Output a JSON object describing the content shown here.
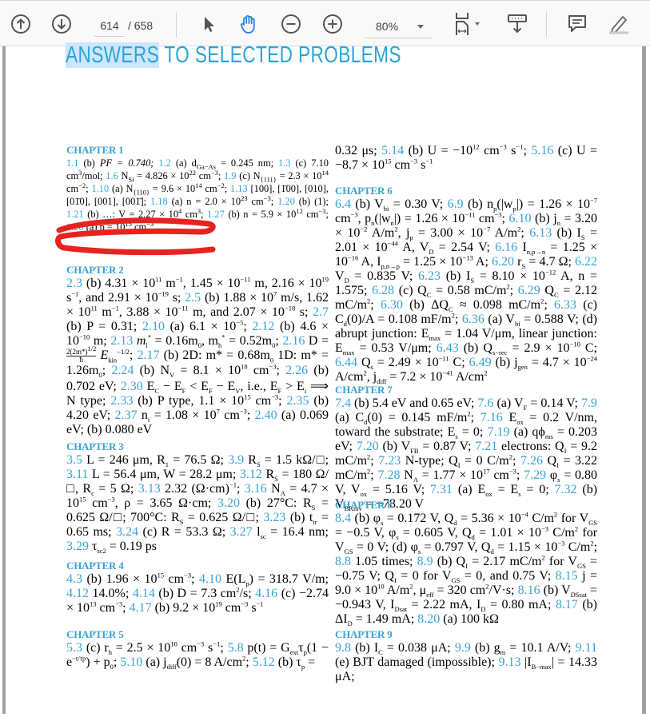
{
  "toolbar": {
    "prev_page_icon": "arrow-up-circle-icon",
    "next_page_icon": "arrow-down-circle-icon",
    "current_page": "614",
    "total_pages": "/ 658",
    "select_tool_icon": "cursor-arrow-icon",
    "hand_tool_icon": "hand-icon",
    "zoom_out_icon": "minus-circle-icon",
    "zoom_in_icon": "plus-circle-icon",
    "zoom_level": "80%",
    "fit_page_icon": "fit-width-icon",
    "scroll_mode_icon": "keyboard-down-icon",
    "comment_icon": "comment-icon",
    "highlight_icon": "pen-highlight-icon",
    "accent_color": "#2b7de9"
  },
  "document": {
    "title_highlighted": "ANSWERS",
    "title_rest": " TO SELECTED PROBLEMS",
    "title_color": "#2ba4d8",
    "highlight_color": "#cde6fb",
    "annotation_color": "#e8231f",
    "chapters": [
      {
        "heading": "CHAPTER 1"
      },
      {
        "heading": "CHAPTER 2"
      },
      {
        "heading": "CHAPTER 3"
      },
      {
        "heading": "CHAPTER 4"
      },
      {
        "heading": "CHAPTER 5"
      },
      {
        "heading": "CHAPTER 6"
      },
      {
        "heading": "CHAPTER 7"
      },
      {
        "heading": "CHAPTER 8"
      },
      {
        "heading": "CHAPTER 9"
      }
    ],
    "ch1": {
      "n1_1": "1.1",
      "t1_1": " (b) ",
      "v1_1": "PF = 0.740; ",
      "n1_2": "1.2",
      "t1_2": " (a) d",
      "s1_2": "Ga−As",
      "v1_2": " = 0.245 nm; ",
      "n1_3": "1.3",
      "t1_3": " (c) 7.10 cm",
      "s1_3": "3",
      "v1_3": "/mol; ",
      "n1_6": "1.6",
      "t1_6": " N",
      "s1_6": "Si",
      "v1_6": " = 4.826 × 10",
      "e1_6": "22",
      "w1_6": " cm",
      "x1_6": "−3",
      "y1_6": "; ",
      "n1_9": "1.9",
      "t1_9": " (c) N",
      "s1_9": "{111}",
      "v1_9": " = 2.3 × 10",
      "e1_9": "14",
      "w1_9": " cm",
      "x1_9": "−2",
      "y1_9": "; ",
      "n1_10": "1.10",
      "t1_10": " (a) N",
      "s1_10": "{110}",
      "v1_10": " = 9.6 × 10",
      "e1_10": "14",
      "w1_10": " cm",
      "x1_10": "−2",
      "y1_10": "; ",
      "n1_13": "1.13",
      "t1_13": " [100], [1̄00], [010], [01̄0], [001], [001̄]; ",
      "n1_18": "1.18",
      "t1_18": " (a) n = 2.0 × 10",
      "e1_18": "23",
      "w1_18": " cm",
      "x1_18": "−3",
      "y1_18": "; ",
      "n1_20": "1.20",
      "t1_20": " (b) (1); ",
      "n1_21": "1.21",
      "t1_21": " (b) ",
      "obscured": "…: V = 2.27 × 10",
      "e_obs": "4",
      "w_obs": " cm",
      "x_obs": "3",
      "y_obs": ";",
      "n1_27": "1.27",
      "t1_27": " (b) n = 5.9 × 10",
      "e1_27": "12",
      "w1_27": " cm",
      "x1_27": "−3",
      "y1_27": "; ",
      "n1_28": "1.28",
      "t1_28": " (a) p = 10",
      "e1_28": "15",
      "w1_28": " cm",
      "x1_28": "−3"
    },
    "ch2": {
      "n2_3": "2.3",
      "t2_3": " (b) 4.31 × 10",
      "e2_3a": "11",
      "a2_3": " m",
      "b2_3": "−1",
      "c2_3": ", 1.45 × 10",
      "d2_3": "−11",
      "f2_3": " m, 2.16 × 10",
      "g2_3": "19",
      "h2_3": " s",
      "i2_3": "−1",
      "j2_3": ", and 2.91 × 10",
      "k2_3": "−19",
      "l2_3": " s; ",
      "n2_5": "2.5",
      "t2_5": " (b) 1.88 × 10",
      "e2_5": "7",
      "a2_5": " m/s, 1.62 × 10",
      "b2_5": "11",
      "c2_5": " m",
      "d2_5": "−1",
      "f2_5": ", 3.88 × 10",
      "g2_5": "−11",
      "h2_5": " m, and 2.07 × 10",
      "i2_5": "−18",
      "j2_5": " s; ",
      "n2_7": "2.7",
      "t2_7": " (b) P = 0.31; ",
      "n2_10": "2.10",
      "t2_10": " (a) 6.1 × 10",
      "e2_10": "−5",
      "y2_10": "; ",
      "n2_12": "2.12",
      "t2_12": " (b) 4.6 × 10",
      "e2_12": "−10",
      "y2_12": " m; ",
      "n2_13": "2.13",
      "t2_13": " m",
      "s2_13a": "l",
      "e2_13a": "*",
      "a2_13": " = 0.16m",
      "b2_13": "0",
      "c2_13": ", m",
      "s2_13b": "h",
      "e2_13b": "*",
      "d2_13": " = 0.52m",
      "f2_13": "0",
      "y2_13": "; ",
      "n2_16": "2.16",
      "t2_16": " D = ",
      "frac_num": "2(2m*)",
      "frac_num_exp": "1/2",
      "frac_den": "ħ",
      "ekin": " E",
      "ekin_sub": "kin",
      "ekin_exp": "−1/2",
      "y2_16": "; ",
      "n2_17": "2.17",
      "t2_17": " (b) 2D: m* = 0.68m",
      "s2_17a": "0",
      "a2_17": " 1D: m* = 1.26m",
      "s2_17b": "0",
      "y2_17": "; ",
      "n2_24": "2.24",
      "t2_24": " (b) N",
      "s2_24": "V",
      "a2_24": " = 8.1 × 10",
      "e2_24": "18",
      "b2_24": " cm",
      "c2_24": "−3",
      "y2_24": "; ",
      "n2_26": "2.26",
      "t2_26": " (b) 0.702 eV; ",
      "n2_30": "2.30",
      "t2_30": " E",
      "s2_30a": "C",
      "a2_30": " − E",
      "s2_30b": "F",
      "b2_30": " < E",
      "s2_30c": "F",
      "c2_30": " − E",
      "s2_30d": "V",
      "d2_30": ", i.e., E",
      "s2_30e": "F",
      "f2_30": " > E",
      "s2_30f": "i",
      "g2_30": " ⟹ N type; ",
      "n2_33": "2.33",
      "t2_33": " (b) P type, 1.1 × 10",
      "e2_33": "15",
      "a2_33": " cm",
      "b2_33": "−3",
      "y2_33": "; ",
      "n2_35": "2.35",
      "t2_35": " (b) 4.20 eV; ",
      "n2_37": "2.37",
      "t2_37": " n",
      "s2_37": "i",
      "a2_37": " = 1.08 × 10",
      "e2_37": "7",
      "b2_37": " cm",
      "c2_37": "−3",
      "y2_37": "; ",
      "n2_40": "2.40",
      "t2_40": " (a) 0.069 eV; (b) 0.080 eV"
    },
    "ch3": {
      "n3_5": "3.5",
      "t3_5": " L = 246 μm, R",
      "s3_5": "1",
      "a3_5": " = 76.5 Ω; ",
      "n3_9": "3.9",
      "t3_9": " R",
      "s3_9": "S",
      "a3_9": " = 1.5 kΩ/□; ",
      "n3_11": "3.11",
      "t3_11": " L = 56.4 μm, W = 28.2 μm; ",
      "n3_12": "3.12",
      "t3_12": " R",
      "s3_12": "S",
      "a3_12": " = 180 Ω/□, R",
      "s3_12b": "c",
      "b3_12": " = 5 Ω; ",
      "n3_13": "3.13",
      "t3_13": " 2.32 (Ω·cm)",
      "e3_13": "−1",
      "y3_13": "; ",
      "n3_16": "3.16",
      "t3_16": " N",
      "s3_16": "A",
      "a3_16": " = 4.7 × 10",
      "e3_16": "15",
      "b3_16": " cm",
      "c3_16": "−3",
      "d3_16": ", ρ = 3.65 Ω·cm; ",
      "n3_20": "3.20",
      "t3_20": " (b) 27°C: R",
      "s3_20": "S",
      "a3_20": " = 0.625 Ω/□; 700°C: R",
      "s3_20b": "S",
      "b3_20": " = 0.625 Ω/□; ",
      "n3_23": "3.23",
      "t3_23": " (b) t",
      "s3_23": "tr",
      "a3_23": " = 0.65 ms; ",
      "n3_24": "3.24",
      "t3_24": " (c) R = 53.3 Ω; ",
      "n3_27": "3.27",
      "t3_27": " l",
      "s3_27": "sc",
      "a3_27": " = 16.4 nm; ",
      "n3_29": "3.29",
      "t3_29": " τ",
      "s3_29": "sc2",
      "a3_29": " = 0.19 ps"
    },
    "ch4": {
      "n4_3": "4.3",
      "t4_3": " (b) 1.96 × 10",
      "e4_3": "15",
      "a4_3": " cm",
      "b4_3": "−3",
      "y4_3": "; ",
      "n4_10": "4.10",
      "t4_10": " E(L",
      "s4_10": "p",
      "a4_10": ") = 318.7 V/m; ",
      "n4_12": "4.12",
      "t4_12": " 14.0%; ",
      "n4_14": "4.14",
      "t4_14": " (b) D = 7.3 cm",
      "e4_14": "2",
      "a4_14": "/s; ",
      "n4_16": "4.16",
      "t4_16": " (c) −2.74 × 10",
      "e4_16": "13",
      "a4_16": " cm",
      "b4_16": "−3",
      "y4_16": "; ",
      "n4_17": "4.17",
      "t4_17": " (b) 9.2 × 10",
      "e4_17": "19",
      "a4_17": " cm",
      "b4_17": "−3",
      "c4_17": " s",
      "d4_17": "−1"
    },
    "ch5": {
      "n5_3": "5.3",
      "t5_3": " (c) r",
      "s5_3": "h",
      "a5_3": " = 2.5 × 10",
      "e5_3": "10",
      "b5_3": " cm",
      "c5_3": "−3",
      "d5_3": " s",
      "f5_3": "−1",
      "y5_3": "; ",
      "n5_8": "5.8",
      "t5_8": " p(t) = G",
      "s5_8a": "ext",
      "a5_8": "τ",
      "s5_8b": "p",
      "b5_8": "(1 − e",
      "e5_8": "−t/τp",
      "c5_8": ") + p",
      "s5_8c": "0",
      "y5_8": "; ",
      "n5_10": "5.10",
      "t5_10": " (a) j",
      "s5_10": "diff",
      "a5_10": "(0) = 8 A/cm",
      "e5_10": "2",
      "y5_10": "; ",
      "n5_12": "5.12",
      "t5_12": " (b) τ",
      "s5_12": "p",
      "a5_12": " = 0.32 μs; ",
      "n5_14": "5.14",
      "t5_14": " (b) U = −10",
      "e5_14": "12",
      "a5_14": " cm",
      "b5_14": "−3",
      "c5_14": " s",
      "d5_14": "−1",
      "y5_14": "; ",
      "n5_16": "5.16",
      "t5_16": " (c) U = −8.7 × 10",
      "e5_16": "15",
      "a5_16": " cm",
      "b5_16": "−3",
      "c5_16": " s",
      "d5_16": "−1"
    },
    "ch6": {
      "n6_4": "6.4",
      "t6_4": " (b) V",
      "s6_4": "bi",
      "a6_4": " = 0.30 V; ",
      "n6_9": "6.9",
      "t6_9": " (b) n",
      "s6_9a": "p",
      "a6_9": "(|w",
      "s6_9b": "p",
      "b6_9": "|) = 1.26 × 10",
      "e6_9a": "−7",
      "c6_9": " cm",
      "d6_9": "−3",
      "f6_9": ", p",
      "s6_9c": "n",
      "g6_9": "(|w",
      "s6_9d": "n",
      "h6_9": "|) = 1.26 × 10",
      "e6_9b": "−11",
      "i6_9": " cm",
      "j6_9": "−3",
      "y6_9": "; ",
      "n6_10": "6.10",
      "t6_10": " (b) j",
      "s6_10a": "n",
      "a6_10": " = 3.20 × 10",
      "e6_10a": "−2",
      "b6_10": " A/m",
      "c6_10": "2",
      "d6_10": ", j",
      "s6_10b": "p",
      "f6_10": " = 3.00 × 10",
      "e6_10b": "−7",
      "g6_10": " A/m",
      "h6_10": "2",
      "y6_10": "; ",
      "n6_13": "6.13",
      "t6_13": " (b) I",
      "s6_13a": "S",
      "a6_13": " = 2.01 × 10",
      "e6_13": "−44",
      "b6_13": " A, V",
      "s6_13b": "D",
      "c6_13": " = 2.54 V; ",
      "n6_16": "6.16",
      "t6_16": " I",
      "s6_16a": "n,p→n",
      "a6_16": " = 1.25 × 10",
      "e6_16a": "−16",
      "b6_16": " A, I",
      "s6_16b": "p,n→p",
      "c6_16": " = 1.25 × 10",
      "e6_16b": "−13",
      "d6_16": " A; ",
      "n6_20": "6.20",
      "t6_20": " r",
      "s6_20": "S",
      "a6_20": " = 4.7 Ω; ",
      "n6_22": "6.22",
      "t6_22": " V",
      "s6_22": "D",
      "a6_22": " = 0.835 V; ",
      "n6_23": "6.23",
      "t6_23": " (b) I",
      "s6_23": "S",
      "a6_23": " = 8.10 × 10",
      "e6_23": "−12",
      "b6_23": " A, n = 1.575; ",
      "n6_28": "6.28",
      "t6_28": " (c) Q",
      "s6_28": "C",
      "a6_28": " = 0.58 mC/m",
      "e6_28": "2",
      "y6_28": "; ",
      "n6_29": "6.29",
      "t6_29": " Q",
      "s6_29": "C",
      "a6_29": " = 2.12 mC/m",
      "e6_29": "2",
      "y6_29": "; ",
      "n6_30": "6.30",
      "t6_30": " (b) ΔQ",
      "s6_30": "C",
      "a6_30": " ≈ 0.098 mC/m",
      "e6_30": "2",
      "y6_30": "; ",
      "n6_33": "6.33",
      "t6_33": " (c) C",
      "s6_33": "d",
      "a6_33": "(0)/A = 0.108 mF/m",
      "e6_33": "2",
      "y6_33": "; ",
      "n6_36": "6.36",
      "t6_36": " (a) V",
      "s6_36a": "bi",
      "a6_36": " = 0.588 V; (d) abrupt junction: E",
      "s6_36b": "max",
      "b6_36": " = 1.04 V/μm, linear junction: E",
      "s6_36c": "max",
      "c6_36": " = 0.53 V/μm; ",
      "n6_43": "6.43",
      "t6_43": " (b) Q",
      "s6_43": "s−rec",
      "a6_43": " = 2.9 × 10",
      "e6_43": "−10",
      "b6_43": " C; ",
      "n6_44": "6.44",
      "t6_44": " Q",
      "s6_44": "s",
      "a6_44": " = 2.49 × 10",
      "e6_44": "−11",
      "b6_44": " C; ",
      "n6_49": "6.49",
      "t6_49": " (b) j",
      "s6_49a": "gen",
      "a6_49": " = 4.7 × 10",
      "e6_49a": "−24",
      "b6_49": " A/cm",
      "c6_49": "2",
      "d6_49": ", j",
      "s6_49b": "diff",
      "f6_49": " = 7.2 × 10",
      "e6_49b": "−41",
      "g6_49": " A/cm",
      "h6_49": "2"
    },
    "ch7": {
      "n7_4": "7.4",
      "t7_4": " (b) 5.4 eV and 0.65 eV; ",
      "n7_6": "7.6",
      "t7_6": " (a) V",
      "s7_6": "F",
      "a7_6": " = 0.14 V; ",
      "n7_9": "7.9",
      "t7_9": " (a) C",
      "s7_9": "d",
      "a7_9": "(0) = 0.145 mF/m",
      "e7_9": "2",
      "y7_9": "; ",
      "n7_16": "7.16",
      "t7_16": " E",
      "s7_16a": "ox",
      "a7_16": " = 0.2 V/nm, toward the substrate; E",
      "s7_16b": "s",
      "b7_16": " = 0; ",
      "n7_19": "7.19",
      "t7_19": " (a) qϕ",
      "s7_19": "ms",
      "a7_19": " = 0.203 eV; ",
      "n7_20": "7.20",
      "t7_20": " (b) V",
      "s7_20": "FB",
      "a7_20": " = 0.87 V; ",
      "n7_21": "7.21",
      "t7_21": " electrons: Q",
      "s7_21": "I",
      "a7_21": " = 9.2 mC/m",
      "e7_21": "2",
      "y7_21": "; ",
      "n7_23": "7.23",
      "t7_23": " N-type; Q",
      "s7_23": "I",
      "a7_23": " = 0 C/m",
      "e7_23": "2",
      "y7_23": "; ",
      "n7_26": "7.26",
      "t7_26": " Q",
      "s7_26": "I",
      "a7_26": " = 3.22 mC/m",
      "e7_26": "2",
      "y7_26": "; ",
      "n7_28": "7.28",
      "t7_28": " N",
      "s7_28": "A",
      "a7_28": " = 1.77 × 10",
      "e7_28": "17",
      "b7_28": " cm",
      "c7_28": "−3",
      "y7_28": "; ",
      "n7_29": "7.29",
      "t7_29": " φ",
      "s7_29a": "s",
      "a7_29": " = 0.80 V, V",
      "s7_29b": "ox",
      "b7_29": " = 5.16 V; ",
      "n7_31": "7.31",
      "t7_31": " (a) E",
      "s7_31a": "ox",
      "a7_31": " = E",
      "s7_31b": "s",
      "b7_31": " = 0; ",
      "n7_32": "7.32",
      "t7_32": " (b) V",
      "s7_32": "BRinv",
      "a7_32": " = −78.20 V"
    },
    "ch8": {
      "n8_4": "8.4",
      "t8_4": " (b) φ",
      "s8_4a": "s",
      "a8_4": " = 0.172 V, Q",
      "s8_4b": "d",
      "b8_4": " = 5.36 × 10",
      "e8_4a": "−4",
      "c8_4": " C/m",
      "e8_4b": "2",
      "d8_4": " for V",
      "s8_4c": "GS",
      "f8_4": " = −0.5 V, φ",
      "s8_4d": "s",
      "g8_4": " = 0.605 V, Q",
      "s8_4e": "d",
      "h8_4": " = 1.01 × 10",
      "e8_4c": "−3",
      "i8_4": " C/m",
      "e8_4d": "2",
      "j8_4": " for V",
      "s8_4f": "GS",
      "k8_4": " = 0 V; (d) φ",
      "s8_4g": "s",
      "l8_4": " = 0.797 V, Q",
      "s8_4h": "d",
      "m8_4": " = 1.15 × 10",
      "e8_4e": "−3",
      "o8_4": " C/m",
      "e8_4f": "2",
      "y8_4": "; ",
      "n8_8": "8.8",
      "t8_8": " 1.05 times; ",
      "n8_9": "8.9",
      "t8_9": " (b) Q",
      "s8_9a": "I",
      "a8_9": " = 2.17 mC/m",
      "e8_9": "2",
      "b8_9": " for V",
      "s8_9b": "GS",
      "c8_9": " = −0.75 V; Q",
      "s8_9c": "I",
      "d8_9": " = 0 for V",
      "s8_9d": "GS",
      "f8_9": " = 0, and 0.75 V; ",
      "n8_15": "8.15",
      "t8_15": " j = 9.0 × 10",
      "e8_15a": "10",
      "a8_15": " A/m",
      "e8_15b": "2",
      "b8_15": ", μ",
      "s8_15": "eff",
      "c8_15": " = 320 cm",
      "e8_15c": "2",
      "d8_15": "/V·s; ",
      "n8_16": "8.16",
      "t8_16": " (b) V",
      "s8_16a": "DSsat",
      "a8_16": " = −0.943 V, I",
      "s8_16b": "Dsat",
      "b8_16": " = 2.22 mA, I",
      "s8_16c": "D",
      "c8_16": " = 0.80 mA; ",
      "n8_17": "8.17",
      "t8_17": " (b) ΔI",
      "s8_17": "D",
      "a8_17": " = 1.49 mA; ",
      "n8_20": "8.20",
      "t8_20": " (a) 100 kΩ"
    },
    "ch9": {
      "n9_8": "9.8",
      "t9_8": " (b) I",
      "s9_8": "C",
      "a9_8": " = 0.038 μA; ",
      "n9_9": "9.9",
      "t9_9": " (b) g",
      "s9_9": "m",
      "a9_9": " = 10.1 A/V; ",
      "n9_11": "9.11",
      "t9_11": " (e) BJT damaged (impossible); ",
      "n9_13": "9.13",
      "t9_13": " |I",
      "s9_13": "B−max",
      "a9_13": "| = 14.33 μA;"
    }
  }
}
